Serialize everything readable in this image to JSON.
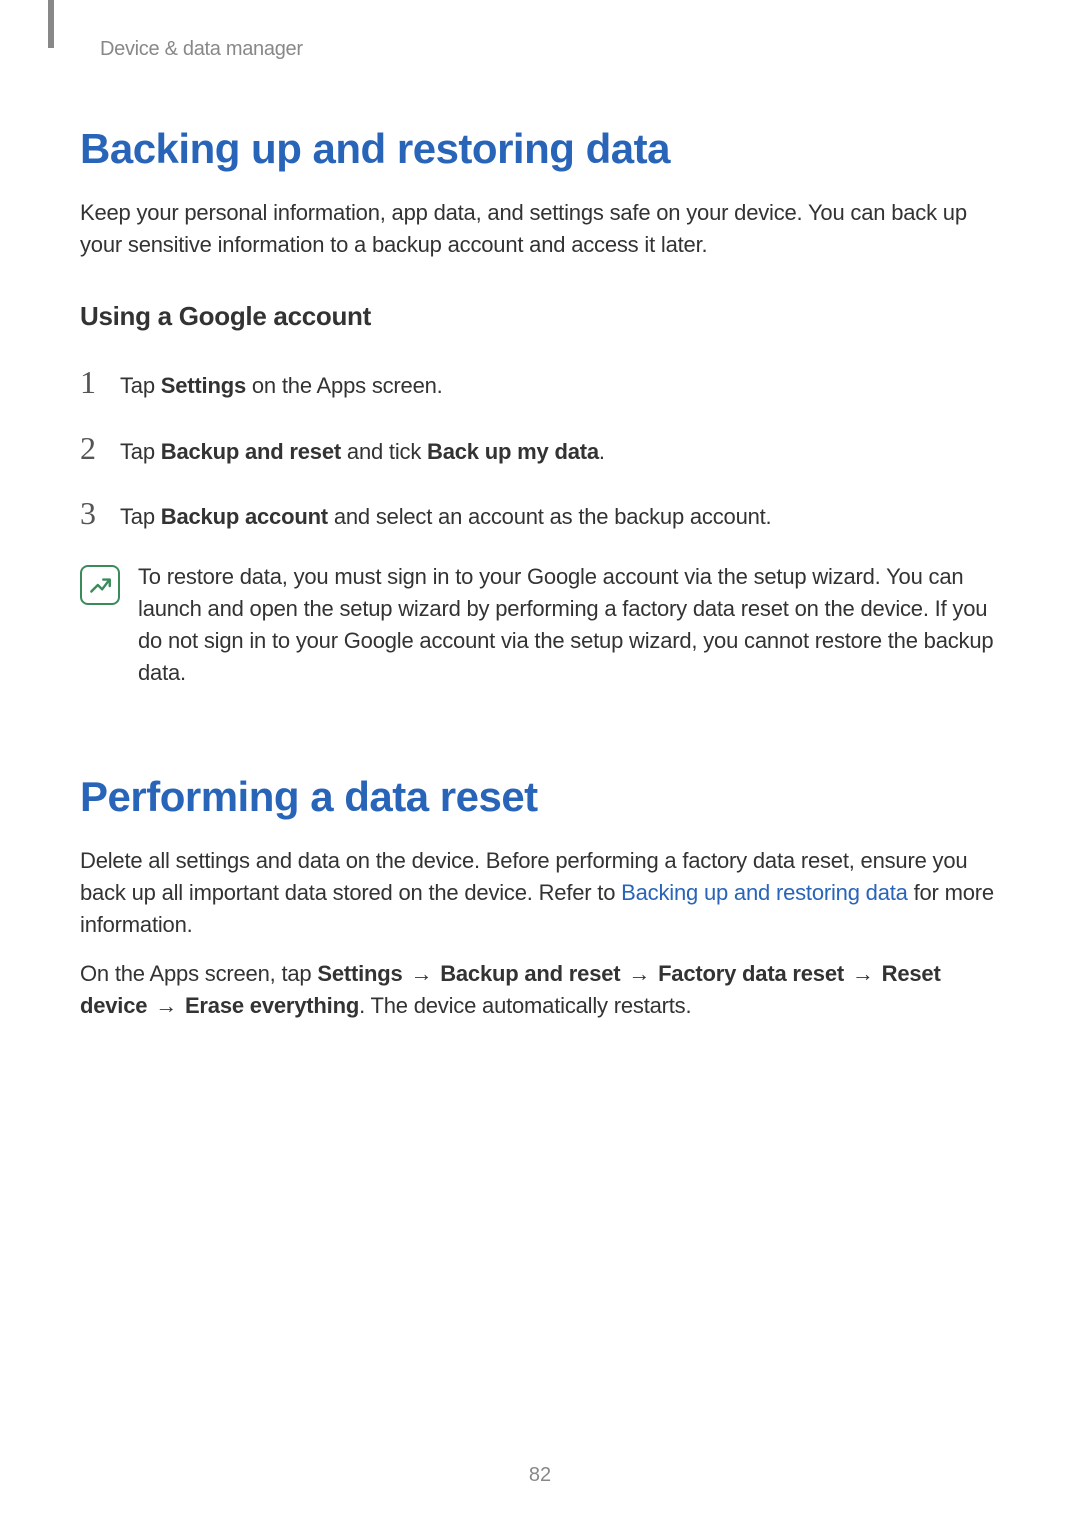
{
  "breadcrumb": "Device & data manager",
  "section1": {
    "title": "Backing up and restoring data",
    "intro": "Keep your personal information, app data, and settings safe on your device. You can back up your sensitive information to a backup account and access it later.",
    "subheading": "Using a Google account",
    "steps": {
      "num1": "1",
      "num2": "2",
      "num3": "3",
      "step1_pre": "Tap ",
      "step1_bold": "Settings",
      "step1_post": " on the Apps screen.",
      "step2_pre": "Tap ",
      "step2_bold1": "Backup and reset",
      "step2_mid": " and tick ",
      "step2_bold2": "Back up my data",
      "step2_post": ".",
      "step3_pre": "Tap ",
      "step3_bold": "Backup account",
      "step3_post": " and select an account as the backup account."
    },
    "note": "To restore data, you must sign in to your Google account via the setup wizard. You can launch and open the setup wizard by performing a factory data reset on the device. If you do not sign in to your Google account via the setup wizard, you cannot restore the backup data."
  },
  "section2": {
    "title": "Performing a data reset",
    "intro_pre": "Delete all settings and data on the device. Before performing a factory data reset, ensure you back up all important data stored on the device. Refer to ",
    "intro_link": "Backing up and restoring data",
    "intro_post": " for more information.",
    "path_pre": "On the Apps screen, tap ",
    "path_1": "Settings",
    "path_2": "Backup and reset",
    "path_3": "Factory data reset",
    "path_4": "Reset device",
    "path_5": "Erase everything",
    "path_post": ". The device automatically restarts.",
    "arrow": "→"
  },
  "pageNumber": "82"
}
